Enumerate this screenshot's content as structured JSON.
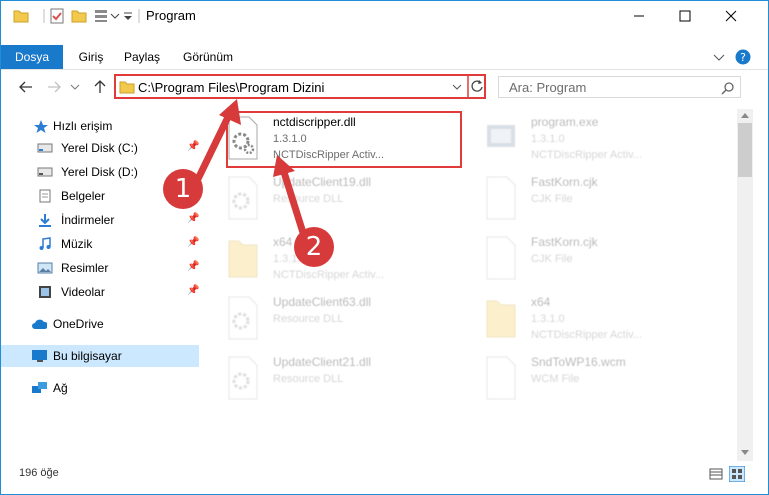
{
  "window": {
    "title": "Program"
  },
  "ribbon": {
    "tabs": [
      {
        "label": "Dosya"
      },
      {
        "label": "Giriş"
      },
      {
        "label": "Paylaş"
      },
      {
        "label": "Görünüm"
      }
    ]
  },
  "address": {
    "path": "C:\\Program Files\\Program Dizini"
  },
  "search": {
    "placeholder": "Ara: Program"
  },
  "sidebar": {
    "items": [
      {
        "label": "Hızlı erişim",
        "icon": "star-icon"
      },
      {
        "label": "Yerel Disk (C:)",
        "icon": "drive-icon",
        "pinned": true
      },
      {
        "label": "Yerel Disk (D:)",
        "icon": "drive-icon"
      },
      {
        "label": "Belgeler",
        "icon": "documents-icon",
        "pinned": true
      },
      {
        "label": "İndirmeler",
        "icon": "download-icon",
        "pinned": true
      },
      {
        "label": "Müzik",
        "icon": "music-icon",
        "pinned": true
      },
      {
        "label": "Resimler",
        "icon": "pictures-icon",
        "pinned": true
      },
      {
        "label": "Videolar",
        "icon": "video-icon",
        "pinned": true
      },
      {
        "label": "OneDrive",
        "icon": "cloud-icon"
      },
      {
        "label": "Bu bilgisayar",
        "icon": "computer-icon",
        "selected": true
      },
      {
        "label": "Ağ",
        "icon": "network-icon"
      }
    ]
  },
  "files": [
    {
      "name": "nctdiscripper.dll",
      "sub1": "1.3.1.0",
      "sub2": "NCTDiscRipper Activ...",
      "icon": "dll-file-icon"
    },
    {
      "name": "program.exe",
      "sub1": "1.3.1.0",
      "sub2": "NCTDiscRipper Activ...",
      "icon": "exe-file-icon"
    },
    {
      "name": "UpdateClient19.dll",
      "sub1": "Resource DLL",
      "sub2": "",
      "icon": "dll-file-icon"
    },
    {
      "name": "FastKorn.cjk",
      "sub1": "CJK File",
      "sub2": "",
      "icon": "blank-file-icon"
    },
    {
      "name": "x64",
      "sub1": "1.3.1.0",
      "sub2": "NCTDiscRipper Activ...",
      "icon": "folder-icon"
    },
    {
      "name": "FastKorn.cjk",
      "sub1": "CJK File",
      "sub2": "",
      "icon": "blank-file-icon"
    },
    {
      "name": "UpdateClient63.dll",
      "sub1": "Resource DLL",
      "sub2": "",
      "icon": "dll-file-icon"
    },
    {
      "name": "x64",
      "sub1": "1.3.1.0",
      "sub2": "NCTDiscRipper Activ...",
      "icon": "folder-icon"
    },
    {
      "name": "UpdateClient21.dll",
      "sub1": "Resource DLL",
      "sub2": "",
      "icon": "dll-file-icon"
    },
    {
      "name": "SndToWP16.wcm",
      "sub1": "WCM File",
      "sub2": "",
      "icon": "blank-file-icon"
    }
  ],
  "status": {
    "count": "196 öğe"
  },
  "annotations": {
    "step1": "1",
    "step2": "2"
  },
  "colors": {
    "accent": "#1979ca",
    "highlight": "#e03a3a",
    "selection": "#cce8ff"
  }
}
